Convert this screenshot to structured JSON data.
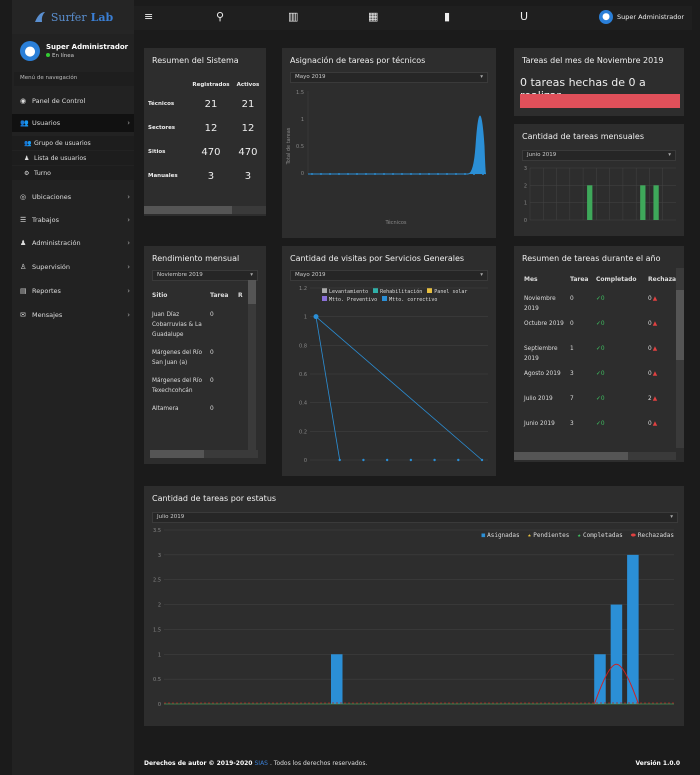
{
  "brand": {
    "name_part1": "Surfer",
    "name_part2": "Lab"
  },
  "topbar": {
    "user": "Super Administrador"
  },
  "user_panel": {
    "name": "Super Administrador",
    "status": "En línea"
  },
  "nav_header": "Menú de navegación",
  "nav": [
    {
      "label": "Panel de Control",
      "icon": "dashboard-icon",
      "chevron": false
    },
    {
      "label": "Usuarios",
      "icon": "users-icon",
      "chevron": true
    },
    {
      "label": "Ubicaciones",
      "icon": "location-icon",
      "chevron": true
    },
    {
      "label": "Trabajos",
      "icon": "list-icon",
      "chevron": true
    },
    {
      "label": "Administración",
      "icon": "admin-icon",
      "chevron": true
    },
    {
      "label": "Supervisión",
      "icon": "supervision-icon",
      "chevron": true
    },
    {
      "label": "Reportes",
      "icon": "report-icon",
      "chevron": true
    },
    {
      "label": "Mensajes",
      "icon": "messages-icon",
      "chevron": true
    }
  ],
  "sub_nav": [
    {
      "label": "Grupo de usuarios"
    },
    {
      "label": "Lista de usuarios"
    },
    {
      "label": "Turno"
    }
  ],
  "summary": {
    "title": "Resumen del Sistema",
    "col1": "Registrados",
    "col2": "Activos",
    "rows": [
      {
        "label": "Técnicos",
        "reg": "21",
        "act": "21"
      },
      {
        "label": "Sectores",
        "reg": "12",
        "act": "12"
      },
      {
        "label": "Sitios",
        "reg": "470",
        "act": "470"
      },
      {
        "label": "Manuales",
        "reg": "3",
        "act": "3"
      }
    ]
  },
  "asignacion": {
    "title": "Asignación de tareas por técnicos",
    "select": "Mayo 2019",
    "ylabel": "Total de tareas",
    "xlabel": "Técnicos"
  },
  "tareas_mes": {
    "title": "Tareas del mes de Noviembre 2019",
    "text": "0 tareas hechas de 0 a realizar",
    "bar_color": "#e0505a",
    "progress": 0
  },
  "cantidad_mensual": {
    "title": "Cantidad de tareas mensuales",
    "select": "Junio 2019"
  },
  "rendimiento": {
    "title": "Rendimiento mensual",
    "select": "Noviembre 2019",
    "col1": "Sitio",
    "col2": "Tarea",
    "col3": "R",
    "rows": [
      {
        "sitio": "Juan Díaz Cobarruvias & La Guadalupe",
        "tarea": "0"
      },
      {
        "sitio": "Márgenes del Río San Juan (a)",
        "tarea": "0"
      },
      {
        "sitio": "Márgenes del Río Texechcohcán",
        "tarea": "0"
      },
      {
        "sitio": "Altamera",
        "tarea": "0"
      }
    ]
  },
  "visitas": {
    "title": "Cantidad de visitas por Servicios Generales",
    "select": "Mayo 2019",
    "legend": [
      "Levantamiento",
      "Rehabilitación",
      "Panel solar",
      "Mtto. Preventivo",
      "Mtto. correctivo"
    ]
  },
  "resumen_anio": {
    "title": "Resumen de tareas durante el año",
    "col1": "Mes",
    "col2": "Tarea",
    "col3": "Completado",
    "col4": "Rechaza",
    "rows": [
      {
        "mes": "Noviembre 2019",
        "tarea": "0",
        "comp": "0",
        "rech": "0"
      },
      {
        "mes": "Octubre 2019",
        "tarea": "0",
        "comp": "0",
        "rech": "0"
      },
      {
        "mes": "Septiembre 2019",
        "tarea": "1",
        "comp": "0",
        "rech": "0"
      },
      {
        "mes": "Agosto 2019",
        "tarea": "3",
        "comp": "0",
        "rech": "0"
      },
      {
        "mes": "Julio 2019",
        "tarea": "7",
        "comp": "0",
        "rech": "2"
      },
      {
        "mes": "Junio 2019",
        "tarea": "3",
        "comp": "0",
        "rech": "0"
      }
    ]
  },
  "estatus": {
    "title": "Cantidad de tareas por estatus",
    "select": "Julio 2019",
    "legend": [
      "Asignadas",
      "Pendientes",
      "Completadas",
      "Rechazadas"
    ]
  },
  "footer": {
    "copyright": "Derechos de autor © 2019-2020",
    "link": "SIAS",
    "rest": ". Todos los derechos reservados.",
    "version": "Versión 1.0.0"
  },
  "chart_data": [
    {
      "type": "line",
      "title": "Asignación de tareas por técnicos",
      "ylim": [
        0,
        1.5
      ],
      "yticks": [
        "0",
        "0.5",
        "1",
        "1.5"
      ],
      "peak_value": 1,
      "xlabel": "Técnicos",
      "ylabel": "Total de tareas"
    },
    {
      "type": "bar",
      "title": "Cantidad de tareas mensuales",
      "ylim": [
        0,
        3
      ],
      "yticks": [
        "0",
        "1",
        "2",
        "3"
      ],
      "values": [
        0,
        0,
        0,
        0,
        2,
        0,
        0,
        0,
        2,
        2,
        0
      ]
    },
    {
      "type": "line",
      "title": "Cantidad de visitas por Servicios Generales",
      "ylim": [
        0,
        1.2
      ],
      "yticks": [
        "0",
        "0.2",
        "0.4",
        "0.6",
        "0.8",
        "1",
        "1.2"
      ],
      "series": [
        {
          "name": "Mtto. correctivo",
          "values": [
            1,
            0,
            0,
            0,
            0,
            0,
            0,
            0
          ]
        },
        {
          "name": "Mtto. Preventivo",
          "values": [
            1,
            0,
            0,
            0,
            0,
            0,
            0,
            0
          ]
        }
      ]
    },
    {
      "type": "bar",
      "title": "Cantidad de tareas por estatus",
      "ylim": [
        0,
        3.5
      ],
      "yticks": [
        "0",
        "0.5",
        "1",
        "1.5",
        "2",
        "2.5",
        "3",
        "3.5"
      ],
      "categories_count": 31,
      "series": [
        {
          "name": "Asignadas",
          "values_at": [
            [
              10,
              1
            ],
            [
              26,
              1
            ],
            [
              27,
              2
            ],
            [
              28,
              3
            ]
          ]
        },
        {
          "name": "Rechazadas",
          "values_at": [
            [
              27,
              0.8
            ]
          ]
        }
      ]
    }
  ]
}
